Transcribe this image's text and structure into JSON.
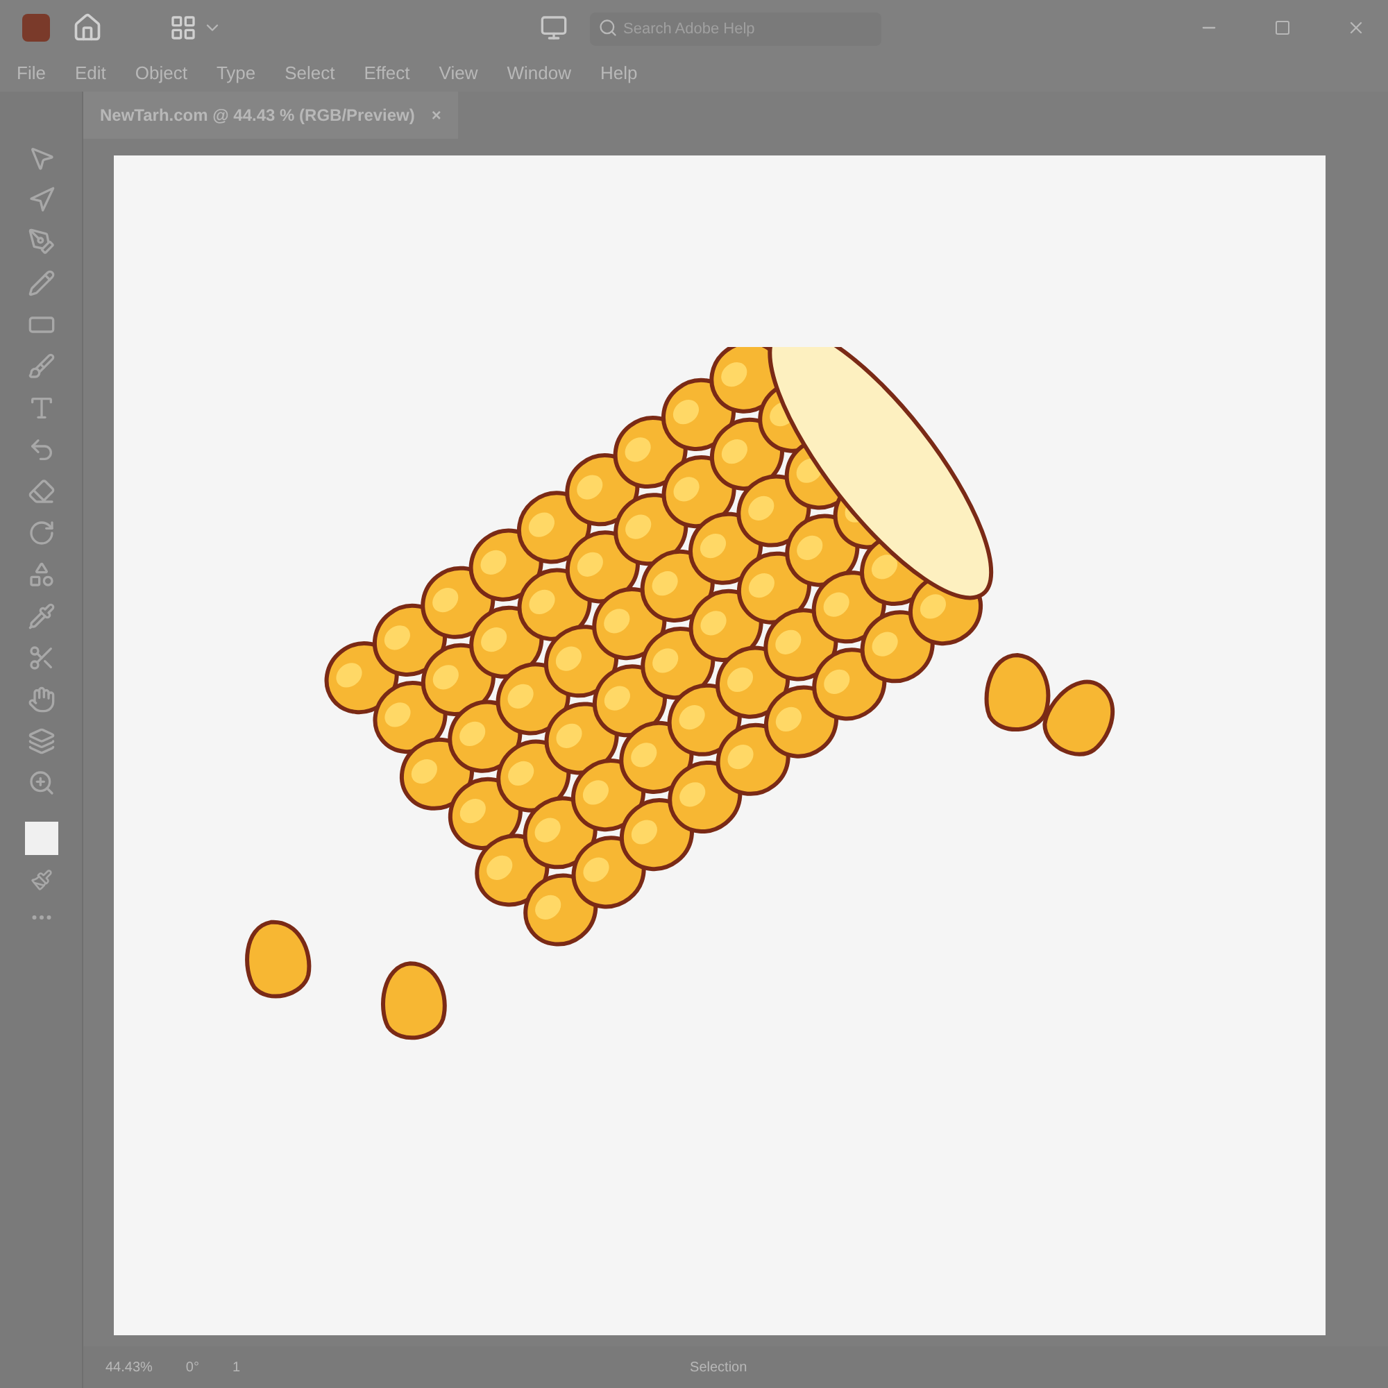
{
  "menu": [
    "File",
    "Edit",
    "Object",
    "Type",
    "Select",
    "Effect",
    "View",
    "Window",
    "Help"
  ],
  "search": {
    "placeholder": "Search Adobe Help"
  },
  "document_tab": {
    "title": "NewTarh.com @ 44.43 % (RGB/Preview)",
    "close": "×"
  },
  "status_bar": {
    "zoom": "44.43%",
    "rotation": "0°",
    "artboard": "1",
    "tool": "Selection"
  }
}
